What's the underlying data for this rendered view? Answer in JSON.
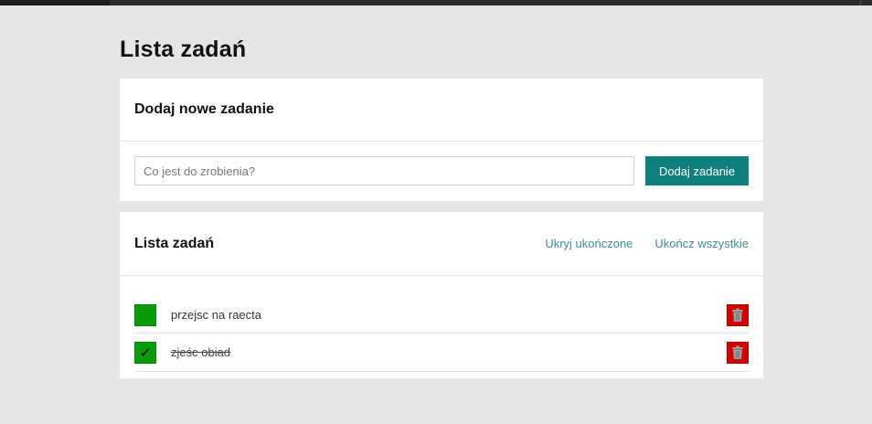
{
  "page": {
    "title": "Lista zadań"
  },
  "add_section": {
    "heading": "Dodaj nowe zadanie",
    "input_value": "",
    "input_placeholder": "Co jest do zrobienia?",
    "button_label": "Dodaj zadanie"
  },
  "list_section": {
    "heading": "Lista zadań",
    "hide_completed_label": "Ukryj ukończone",
    "complete_all_label": "Ukończ wszystkie",
    "items": [
      {
        "text": "przejsc na raecta",
        "completed": false,
        "check_glyph": ""
      },
      {
        "text": "zjeśc obiad",
        "completed": true,
        "check_glyph": "✓"
      }
    ]
  },
  "icons": {
    "checkbox": "checkbox-icon",
    "delete": "trash-icon"
  },
  "colors": {
    "background": "#e6e6e6",
    "accent": "#0f7f7e",
    "link": "#3e8e92",
    "checkbox": "#0a9a0a",
    "delete": "#d40000"
  }
}
